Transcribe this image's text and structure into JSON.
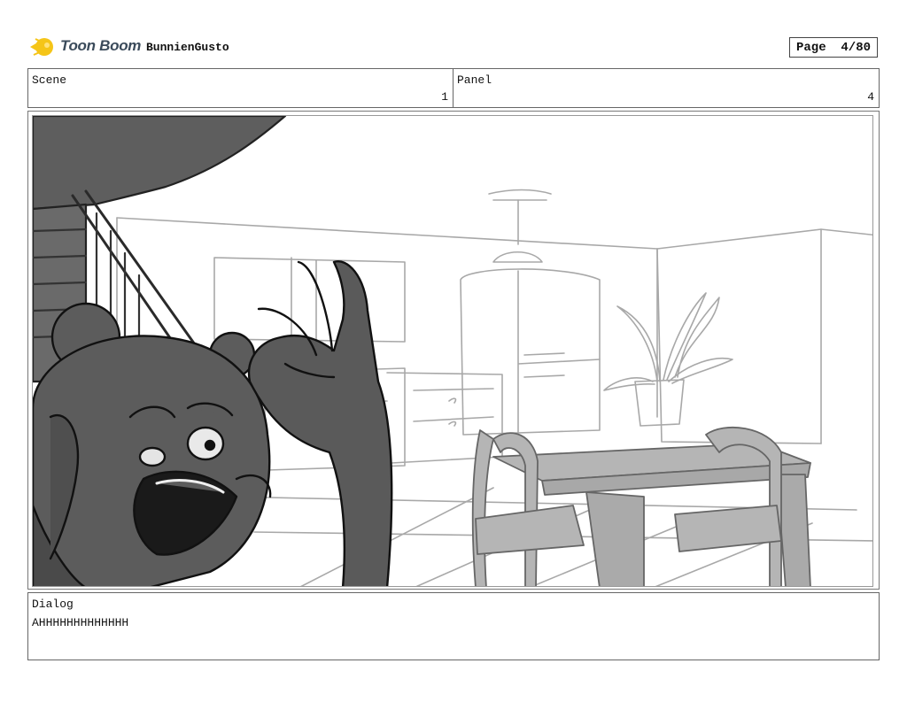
{
  "header": {
    "brand": "Toon Boom",
    "project": "BunnienGusto",
    "page_label": "Page",
    "page_value": "4/80"
  },
  "scene": {
    "label": "Scene",
    "value": "1"
  },
  "panel": {
    "label": "Panel",
    "value": "4"
  },
  "dialog": {
    "label": "Dialog",
    "text": "AHHHHHHHHHHHHH"
  },
  "colors": {
    "logo_yellow": "#f5c518",
    "sketch_dark": "#555555",
    "sketch_light": "#9a9a9a"
  }
}
